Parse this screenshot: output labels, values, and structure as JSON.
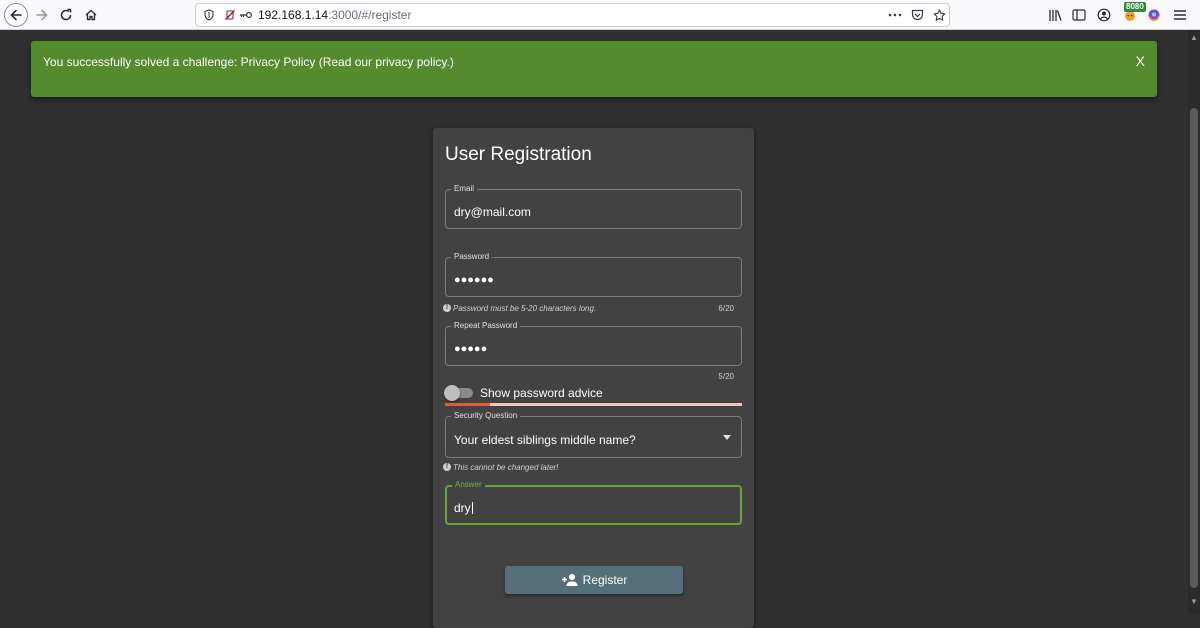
{
  "browser": {
    "url_host": "192.168.1.14",
    "url_rest": ":3000/#/register",
    "extension_badge": "8080",
    "icons": [
      "back-icon",
      "forward-icon",
      "reload-icon",
      "home-icon",
      "shield-icon",
      "mic-blocked-icon",
      "key-icon",
      "more-icon",
      "pocket-icon",
      "bookmark-star-icon",
      "library-icon",
      "sidebar-icon",
      "account-icon",
      "extension-icon",
      "firefox-icon",
      "menu-icon"
    ]
  },
  "snackbar": {
    "message": "You successfully solved a challenge: Privacy Policy (Read our privacy policy.)",
    "close_label": "X",
    "color": "#558b2f"
  },
  "form": {
    "title": "User Registration",
    "email": {
      "label": "Email",
      "value": "dry@mail.com"
    },
    "password": {
      "label": "Password",
      "masked_value": "●●●●●●",
      "hint": "Password must be 5-20 characters long.",
      "counter": "6/20"
    },
    "repeat_password": {
      "label": "Repeat Password",
      "masked_value": "●●●●●",
      "counter": "5/20"
    },
    "password_advice": {
      "label": "Show password advice",
      "enabled": false,
      "strength_fraction": 0.15
    },
    "security_question": {
      "label": "Security Question",
      "selected": "Your eldest siblings middle name?",
      "hint": "This cannot be changed later!"
    },
    "answer": {
      "label": "Answer",
      "value": "dry"
    },
    "register_button": {
      "label": "Register"
    },
    "accent_color": "#7cb342",
    "button_color": "#546e7a"
  }
}
